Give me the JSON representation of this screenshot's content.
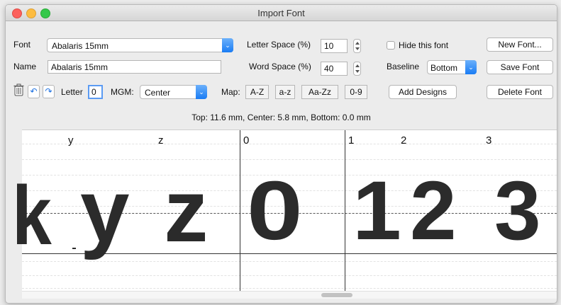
{
  "window": {
    "title": "Import Font"
  },
  "controls": {
    "font_label": "Font",
    "font_value": "Abalaris 15mm",
    "name_label": "Name",
    "name_value": "Abalaris 15mm",
    "letter_space_label": "Letter Space (%)",
    "letter_space_value": "10",
    "word_space_label": "Word Space (%)",
    "word_space_value": "40",
    "hide_font_label": "Hide this font",
    "hide_font_checked": false,
    "baseline_label": "Baseline",
    "baseline_value": "Bottom",
    "letter_label": "Letter",
    "letter_value": "0",
    "mgm_label": "MGM:",
    "mgm_value": "Center",
    "map_label": "Map:",
    "map_buttons": [
      "A-Z",
      "a-z",
      "Aa-Zz",
      "0-9"
    ]
  },
  "buttons": {
    "new_font": "New Font...",
    "save_font": "Save Font",
    "add_designs": "Add Designs",
    "delete_font": "Delete Font"
  },
  "metrics_text": "Top: 11.6 mm, Center: 5.8 mm, Bottom: 0.0 mm",
  "preview": {
    "header_labels": [
      "y",
      "z",
      "0",
      "1",
      "2",
      "3"
    ],
    "glyphs": [
      "k",
      "y",
      "z",
      "0",
      "1",
      "2",
      "3"
    ],
    "glyph_color": "#2b2b2b"
  }
}
